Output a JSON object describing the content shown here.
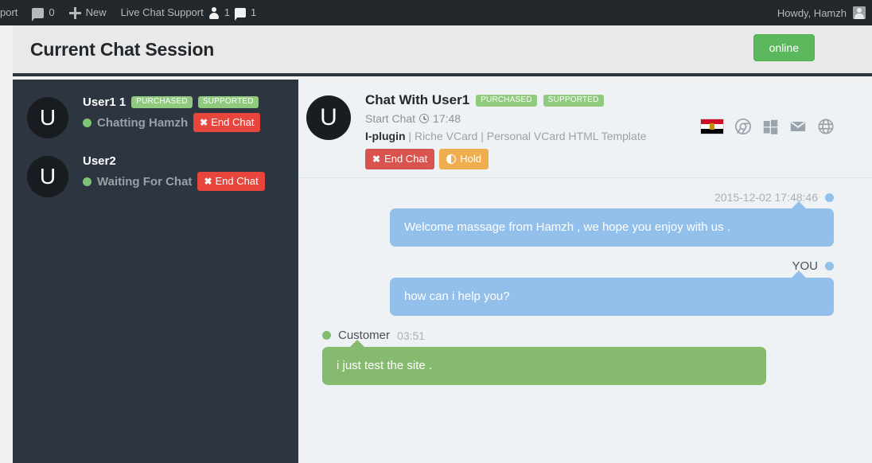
{
  "adminbar": {
    "site_label": "port",
    "comments_icon": "comment-icon",
    "comments_count": "0",
    "new_icon": "plus-icon",
    "new_label": "New",
    "plugin_label": "Live Chat Support",
    "users_icon": "user-icon",
    "users_count": "1",
    "chats_icon": "comment-icon",
    "chats_count": "1",
    "howdy": "Howdy, Hamzh",
    "avatar_icon": "avatar-icon"
  },
  "page": {
    "title": "Current Chat Session",
    "status_label": "online",
    "status_color": "#5cb85c"
  },
  "sidebar": {
    "users": [
      {
        "initial": "U",
        "name": "User1 1",
        "tags": [
          "PURCHASED",
          "SUPPORTED"
        ],
        "status": "Chatting Hamzh",
        "status_dot": "#7cc576",
        "end_chat_label": "End Chat"
      },
      {
        "initial": "U",
        "name": "User2",
        "tags": [],
        "status": "Waiting For Chat",
        "status_dot": "#7cc576",
        "end_chat_label": "End Chat"
      }
    ]
  },
  "chat_header": {
    "initial": "U",
    "title": "Chat With User1",
    "tags": [
      "PURCHASED",
      "SUPPORTED"
    ],
    "start_chat_label": "Start Chat",
    "clock_icon": "clock-icon",
    "start_chat_time": "17:48",
    "plugin_name": "I-plugin",
    "plugin_detail": " | Riche VCard | Personal VCard HTML Template",
    "end_chat_label": "End Chat",
    "hold_label": "Hold",
    "icons": [
      {
        "name": "flag-egypt-icon",
        "title": "Egypt"
      },
      {
        "name": "chrome-icon",
        "title": "Chrome"
      },
      {
        "name": "windows-icon",
        "title": "Windows"
      },
      {
        "name": "envelope-icon",
        "title": "Email"
      },
      {
        "name": "globe-icon",
        "title": "Website"
      }
    ]
  },
  "messages": [
    {
      "side": "right",
      "sender": "",
      "timestamp": "2015-12-02 17:48:46",
      "dot_color": "#92c0ea",
      "text": "Welcome massage from Hamzh , we hope you enjoy with us .",
      "bubble_color": "#92c0ea"
    },
    {
      "side": "right",
      "sender": "YOU",
      "timestamp": "",
      "dot_color": "#92c0ea",
      "text": "how can i help you?",
      "bubble_color": "#92c0ea"
    },
    {
      "side": "left",
      "sender": "Customer",
      "timestamp": "03:51",
      "dot_color": "#82bc6e",
      "text": "i just test the site .",
      "bubble_color": "#86bb6f"
    }
  ]
}
